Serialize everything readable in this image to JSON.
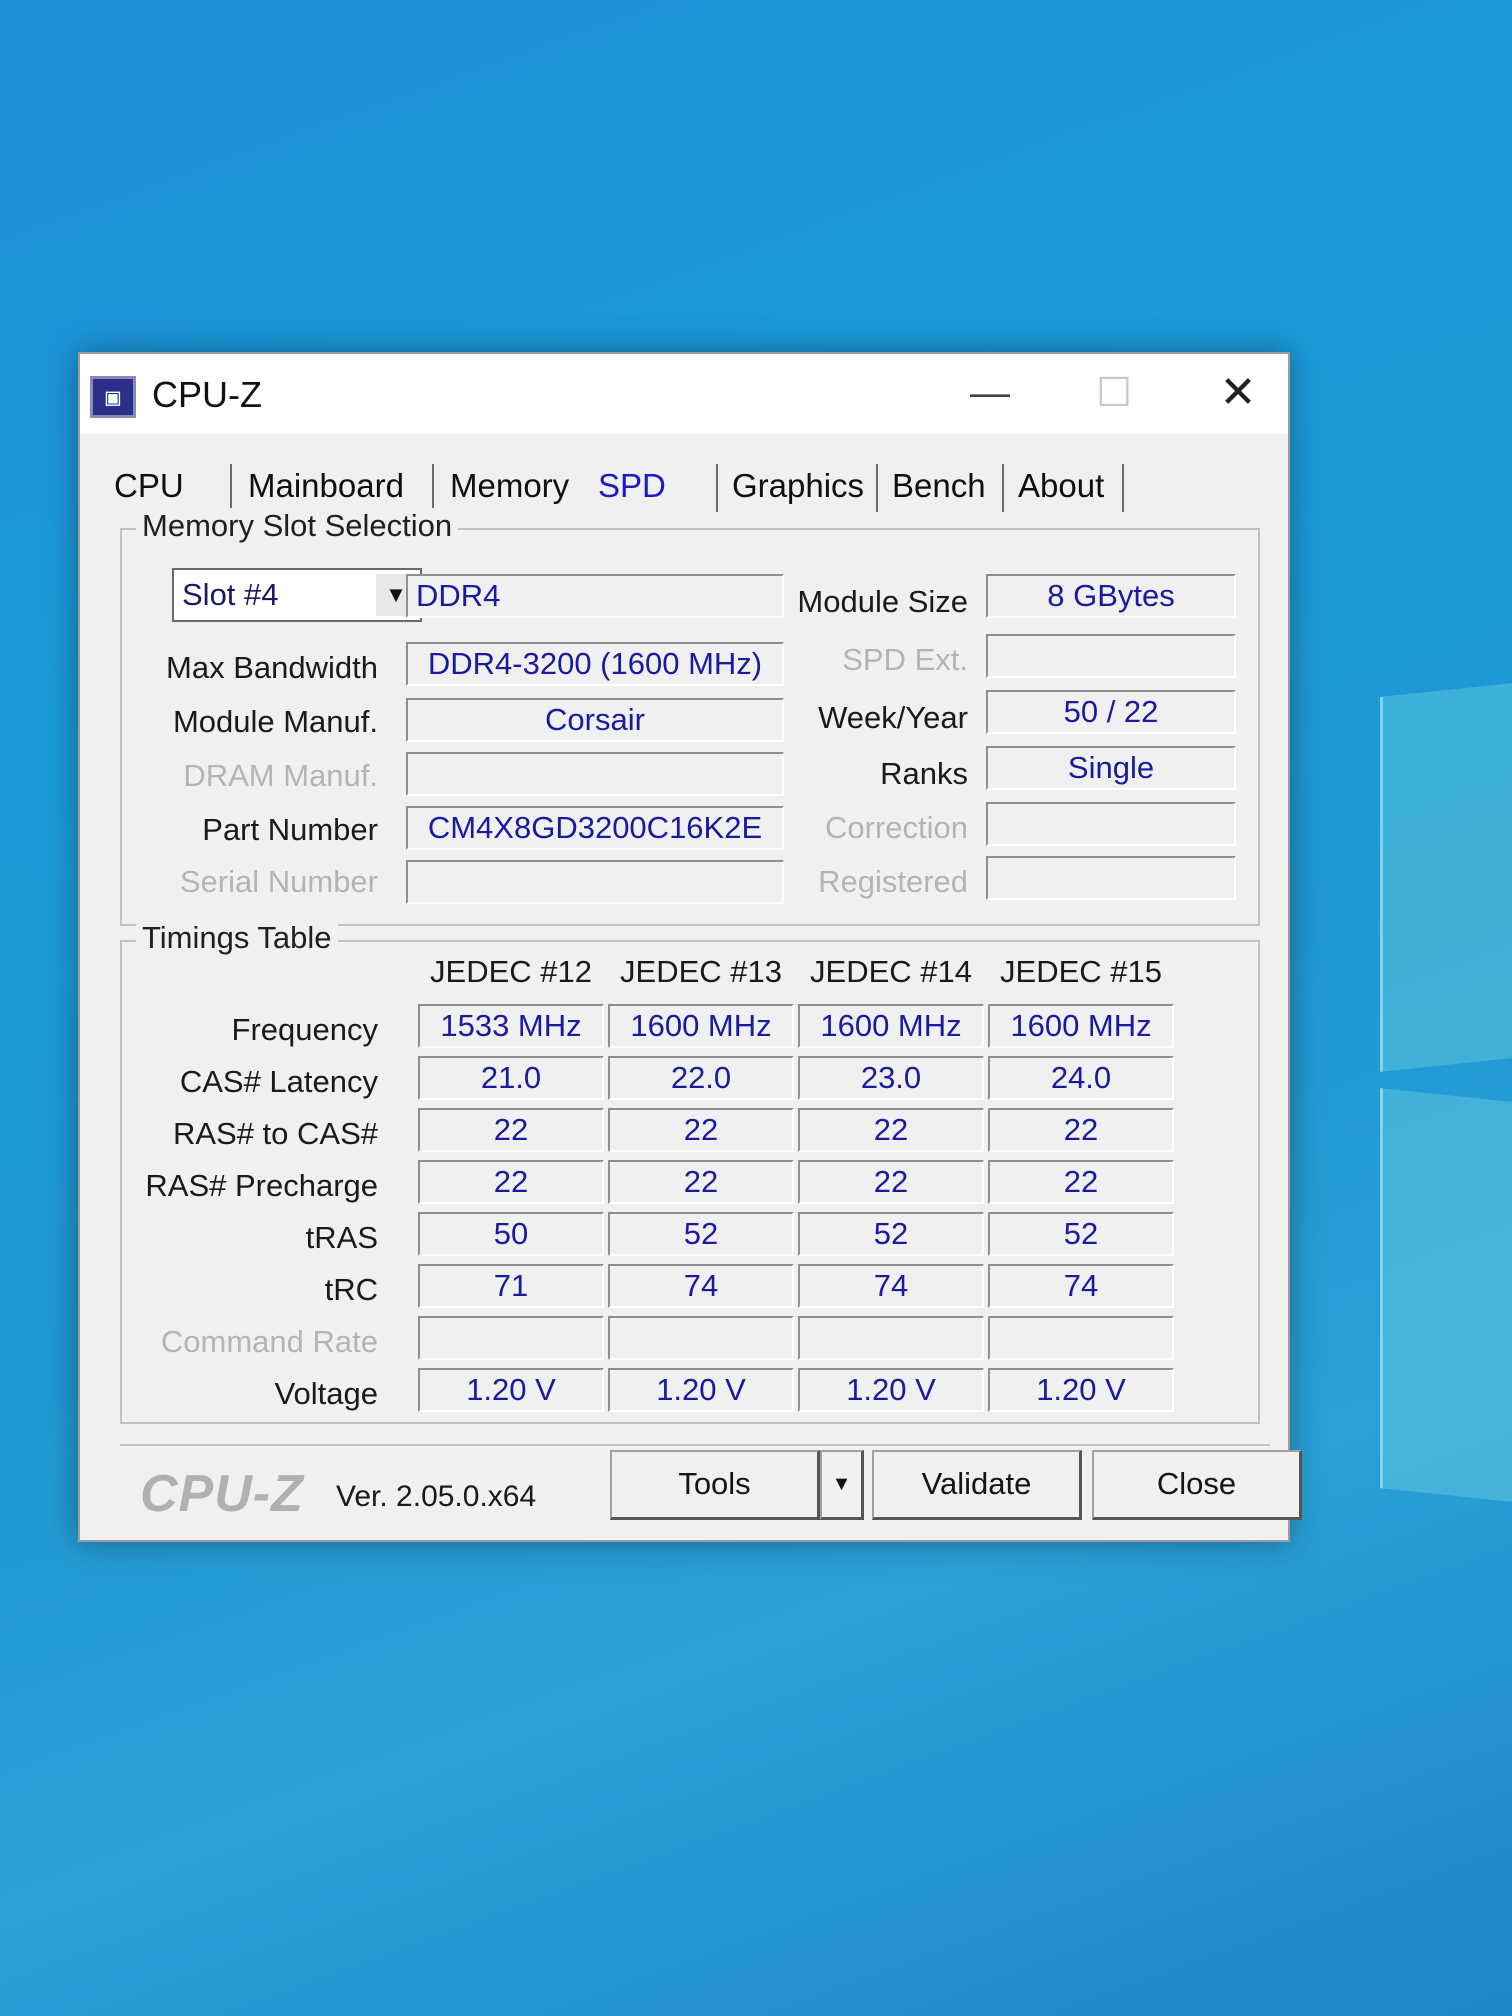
{
  "window": {
    "title": "CPU-Z",
    "minimize": "—",
    "maximize": "☐",
    "close": "✕"
  },
  "tabs": [
    "CPU",
    "Mainboard",
    "Memory",
    "SPD",
    "Graphics",
    "Bench",
    "About"
  ],
  "active_tab": "SPD",
  "slot": {
    "group_title": "Memory Slot Selection",
    "selected_slot": "Slot #4",
    "type": "DDR4",
    "labels": {
      "max_bandwidth": "Max Bandwidth",
      "module_manuf": "Module Manuf.",
      "dram_manuf": "DRAM Manuf.",
      "part_number": "Part Number",
      "serial_number": "Serial Number",
      "module_size": "Module Size",
      "spd_ext": "SPD Ext.",
      "week_year": "Week/Year",
      "ranks": "Ranks",
      "correction": "Correction",
      "registered": "Registered"
    },
    "values": {
      "max_bandwidth": "DDR4-3200 (1600 MHz)",
      "module_manuf": "Corsair",
      "dram_manuf": "",
      "part_number": "CM4X8GD3200C16K2E",
      "serial_number": "",
      "module_size": "8 GBytes",
      "spd_ext": "",
      "week_year": "50 / 22",
      "ranks": "Single",
      "correction": "",
      "registered": ""
    }
  },
  "timings": {
    "group_title": "Timings Table",
    "columns": [
      "JEDEC #12",
      "JEDEC #13",
      "JEDEC #14",
      "JEDEC #15"
    ],
    "rows": [
      {
        "label": "Frequency",
        "values": [
          "1533 MHz",
          "1600 MHz",
          "1600 MHz",
          "1600 MHz"
        ]
      },
      {
        "label": "CAS# Latency",
        "values": [
          "21.0",
          "22.0",
          "23.0",
          "24.0"
        ]
      },
      {
        "label": "RAS# to CAS#",
        "values": [
          "22",
          "22",
          "22",
          "22"
        ]
      },
      {
        "label": "RAS# Precharge",
        "values": [
          "22",
          "22",
          "22",
          "22"
        ]
      },
      {
        "label": "tRAS",
        "values": [
          "50",
          "52",
          "52",
          "52"
        ]
      },
      {
        "label": "tRC",
        "values": [
          "71",
          "74",
          "74",
          "74"
        ]
      },
      {
        "label": "Command Rate",
        "values": [
          "",
          "",
          "",
          ""
        ]
      },
      {
        "label": "Voltage",
        "values": [
          "1.20 V",
          "1.20 V",
          "1.20 V",
          "1.20 V"
        ]
      }
    ]
  },
  "footer": {
    "brand": "CPU-Z",
    "version": "Ver. 2.05.0.x64",
    "tools": "Tools",
    "tools_arrow": "▼",
    "validate": "Validate",
    "close": "Close"
  }
}
